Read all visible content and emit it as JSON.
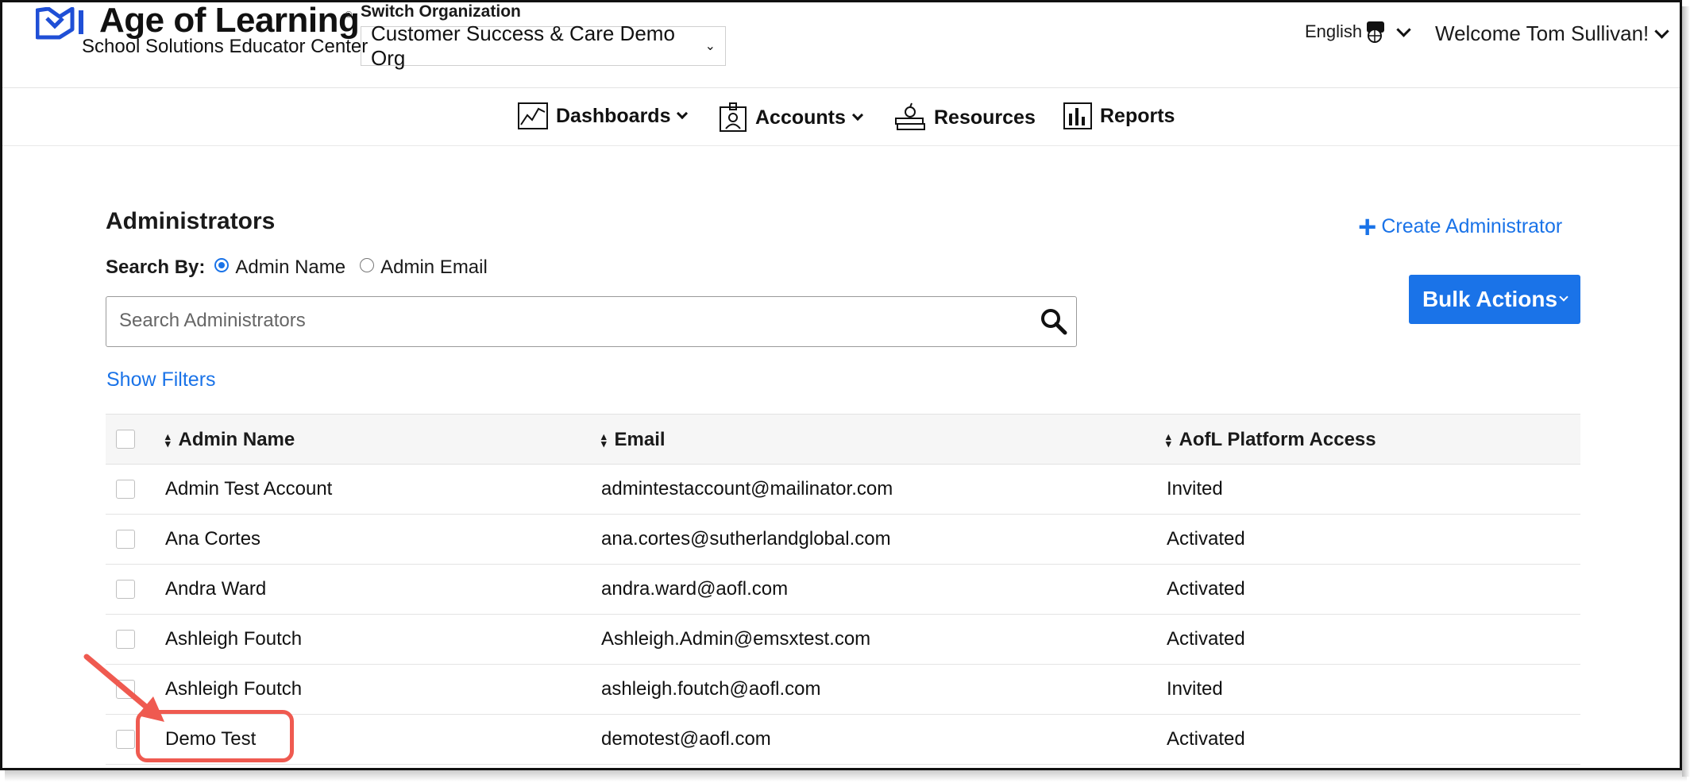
{
  "header": {
    "brand_title": "Age of Learning",
    "brand_registered": "®",
    "brand_subtitle": "School Solutions Educator Center",
    "switch_org_label": "Switch Organization",
    "org_selected": "Customer Success & Care Demo Org",
    "language": "English",
    "welcome": "Welcome Tom Sullivan!"
  },
  "nav": {
    "items": [
      {
        "label": "Dashboards",
        "icon": "chart-icon",
        "dropdown": true
      },
      {
        "label": "Accounts",
        "icon": "id-badge-icon",
        "dropdown": true
      },
      {
        "label": "Resources",
        "icon": "books-apple-icon",
        "dropdown": false
      },
      {
        "label": "Reports",
        "icon": "bar-chart-icon",
        "dropdown": false
      }
    ]
  },
  "main": {
    "title": "Administrators",
    "search_by_label": "Search By:",
    "search_options": [
      "Admin Name",
      "Admin Email"
    ],
    "search_selected": "Admin Name",
    "search_placeholder": "Search Administrators",
    "show_filters": "Show Filters",
    "create_admin": "Create Administrator",
    "bulk_actions": "Bulk Actions"
  },
  "table": {
    "columns": [
      "Admin Name",
      "Email",
      "AofL Platform Access"
    ],
    "rows": [
      {
        "name": "Admin Test Account",
        "email": "admintestaccount@mailinator.com",
        "access": "Invited"
      },
      {
        "name": "Ana Cortes",
        "email": "ana.cortes@sutherlandglobal.com",
        "access": "Activated"
      },
      {
        "name": "Andra Ward",
        "email": "andra.ward@aofl.com",
        "access": "Activated"
      },
      {
        "name": "Ashleigh Foutch",
        "email": "Ashleigh.Admin@emsxtest.com",
        "access": "Activated"
      },
      {
        "name": "Ashleigh Foutch",
        "email": "ashleigh.foutch@aofl.com",
        "access": "Invited"
      },
      {
        "name": "Demo Test",
        "email": "demotest@aofl.com",
        "access": "Activated"
      }
    ]
  },
  "colors": {
    "accent": "#1a73e8",
    "brand_blue": "#1f4fd6",
    "annotation": "#ef5a50"
  }
}
